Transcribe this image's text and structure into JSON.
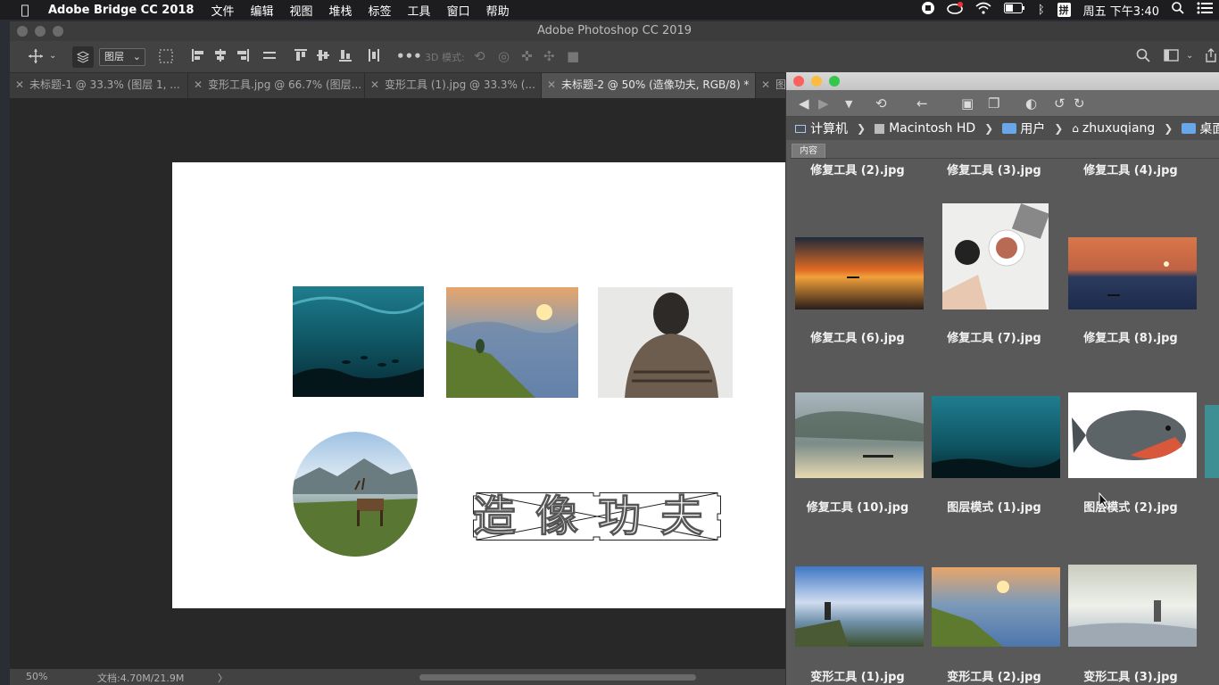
{
  "menubar": {
    "app_name": "Adobe Bridge CC 2018",
    "menus": [
      "文件",
      "编辑",
      "视图",
      "堆栈",
      "标签",
      "工具",
      "窗口",
      "帮助"
    ],
    "clock": "周五 下午3:40",
    "input_method": "拼"
  },
  "photoshop": {
    "window_title": "Adobe Photoshop CC 2019",
    "options": {
      "layer_select": "图层",
      "mode_3d": "3D 模式:"
    },
    "tabs": [
      {
        "label": "未标题-1 @ 33.3% (图层 1, ...",
        "active": false
      },
      {
        "label": "变形工具.jpg @ 66.7% (图层...",
        "active": false
      },
      {
        "label": "变形工具 (1).jpg @ 33.3% (...",
        "active": false
      },
      {
        "label": "未标题-2 @ 50% (造像功夫, RGB/8) *",
        "active": true
      },
      {
        "label": "图",
        "active": false
      }
    ],
    "canvas_text": "造像功夫",
    "status": {
      "zoom": "50%",
      "doc_size": "文档:4.70M/21.9M",
      "arrow": "〉"
    }
  },
  "bridge": {
    "path": [
      {
        "label": "计算机"
      },
      {
        "label": "Macintosh HD"
      },
      {
        "label": "用户"
      },
      {
        "label": "zhuxuqiang"
      },
      {
        "label": "桌面"
      }
    ],
    "panel_tab": "内容",
    "captions_row0": [
      "修复工具 (2).jpg",
      "修复工具 (3).jpg",
      "修复工具 (4).jpg"
    ],
    "captions_row1": [
      "修复工具 (6).jpg",
      "修复工具 (7).jpg",
      "修复工具 (8).jpg"
    ],
    "captions_row2": [
      "修复工具 (10).jpg",
      "图层模式 (1).jpg",
      "图层模式 (2).jpg"
    ],
    "captions_row3": [
      "变形工具 (1).jpg",
      "变形工具 (2).jpg",
      "变形工具 (3).jpg"
    ]
  },
  "colors": {
    "accent_red": "#fc605c",
    "accent_yellow": "#fdbc40",
    "accent_green": "#34c84a",
    "folder_blue": "#6aa7e8"
  }
}
